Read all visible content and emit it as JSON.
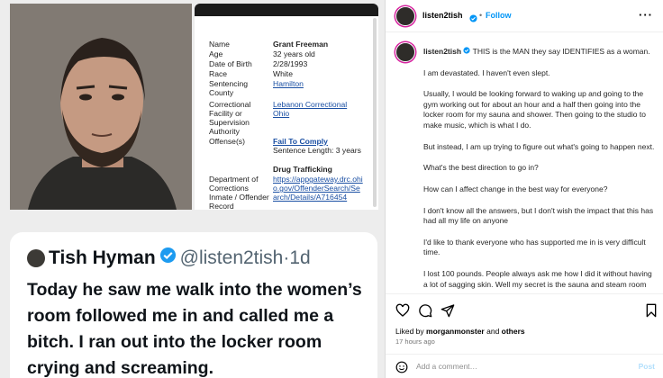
{
  "record": {
    "rows": [
      {
        "label": "Name",
        "value": "Grant Freeman",
        "style": "bold"
      },
      {
        "label": "Age",
        "value": "32 years old",
        "style": "plain"
      },
      {
        "label": "Date of Birth",
        "value": "2/28/1993",
        "style": "plain"
      },
      {
        "label": "Race",
        "value": "White",
        "style": "plain"
      },
      {
        "label": "Sentencing County",
        "value": "Hamilton",
        "style": "link"
      },
      {
        "label": "Correctional Facility or Supervision Authority",
        "value": "Lebanon Correctional Ohio",
        "style": "link"
      },
      {
        "label": "Offense(s)",
        "value": "Fail To Comply",
        "style": "boldlink"
      }
    ],
    "sentence_length": "Sentence Length: 3 years",
    "offense2": "Drug Trafficking",
    "dept_label": "Department of Corrections Inmate / Offender Record",
    "dept_url": "https://appgateway.drc.ohio.gov/OffenderSearch/Search/Details/A716454"
  },
  "tweet": {
    "name": "Tish Hyman",
    "handle": "@listen2tish",
    "sep": "·",
    "age": "1d",
    "text": "Today he saw me walk into the women’s room followed me in and called me a bitch. I ran out into the locker room crying and screaming."
  },
  "ig": {
    "username": "listen2tish",
    "dot": "•",
    "follow_label": "Follow",
    "more_label": "···",
    "caption_first": "THIS is the MAN they say IDENTIFIES as a woman.",
    "paragraphs": [
      "I am devastated. I haven't even slept.",
      "Usually, I would be looking forward to waking up and going to the gym working out for about an hour and a half then going into the locker room for my sauna and shower. Then going to the studio to make music, which is what I do.",
      "But instead, I am up trying to figure out what's going to happen next.",
      "What's the best direction to go in?",
      "How can I affect change in the best way for everyone?",
      "I don't know all the answers, but I don't wish the impact that this has had all my life on anyone",
      "I'd like to thank everyone who has supported me in is very difficult time.",
      "I lost 100 pounds. People always ask me how I did it without having a lot of sagging skin. Well my secret is the sauna and steam room and that's why I am really devastated right now because I no longer"
    ],
    "likes_prefix": "Liked by ",
    "likes_user": "morganmonster",
    "likes_and": " and ",
    "likes_others": "others",
    "time": "17 hours ago",
    "comment_placeholder": "Add a comment…",
    "post_label": "Post",
    "brand_color": "#0095f6",
    "verified_color": "#1d9bf0"
  }
}
